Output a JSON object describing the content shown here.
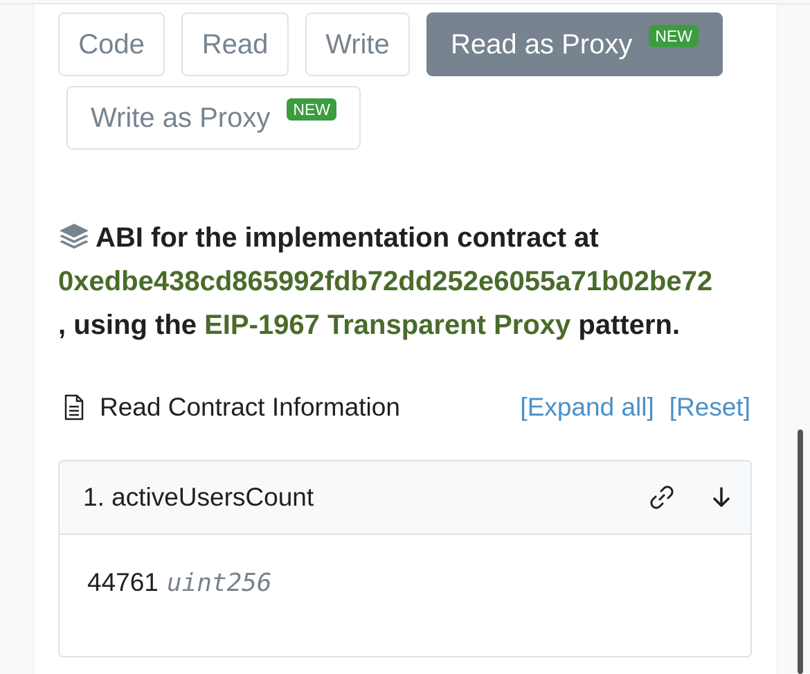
{
  "tabs": [
    {
      "label": "Code"
    },
    {
      "label": "Read"
    },
    {
      "label": "Write"
    },
    {
      "label": "Read as Proxy",
      "badge": "NEW",
      "active": true
    },
    {
      "label": "Write as Proxy",
      "badge": "NEW"
    }
  ],
  "abi": {
    "prefix": "ABI for the implementation contract at",
    "address": "0xedbe438cd865992fdb72dd252e6055a71b02be72",
    "middle": ", using the",
    "pattern_link": "EIP-1967 Transparent Proxy",
    "suffix": "pattern."
  },
  "section": {
    "title": "Read Contract Information",
    "expand_all": "[Expand all]",
    "reset": "[Reset]"
  },
  "functions": [
    {
      "name": "1. activeUsersCount",
      "value": "44761",
      "type": "uint256"
    }
  ],
  "icons": {
    "layers": "layers-icon",
    "document": "document-icon",
    "link": "link-icon",
    "expand": "arrow-down-icon"
  },
  "colors": {
    "active_tab": "#77838f",
    "badge": "#3b9d3f",
    "address_link": "#4a6b2a",
    "blue_link": "#4a90c8"
  }
}
